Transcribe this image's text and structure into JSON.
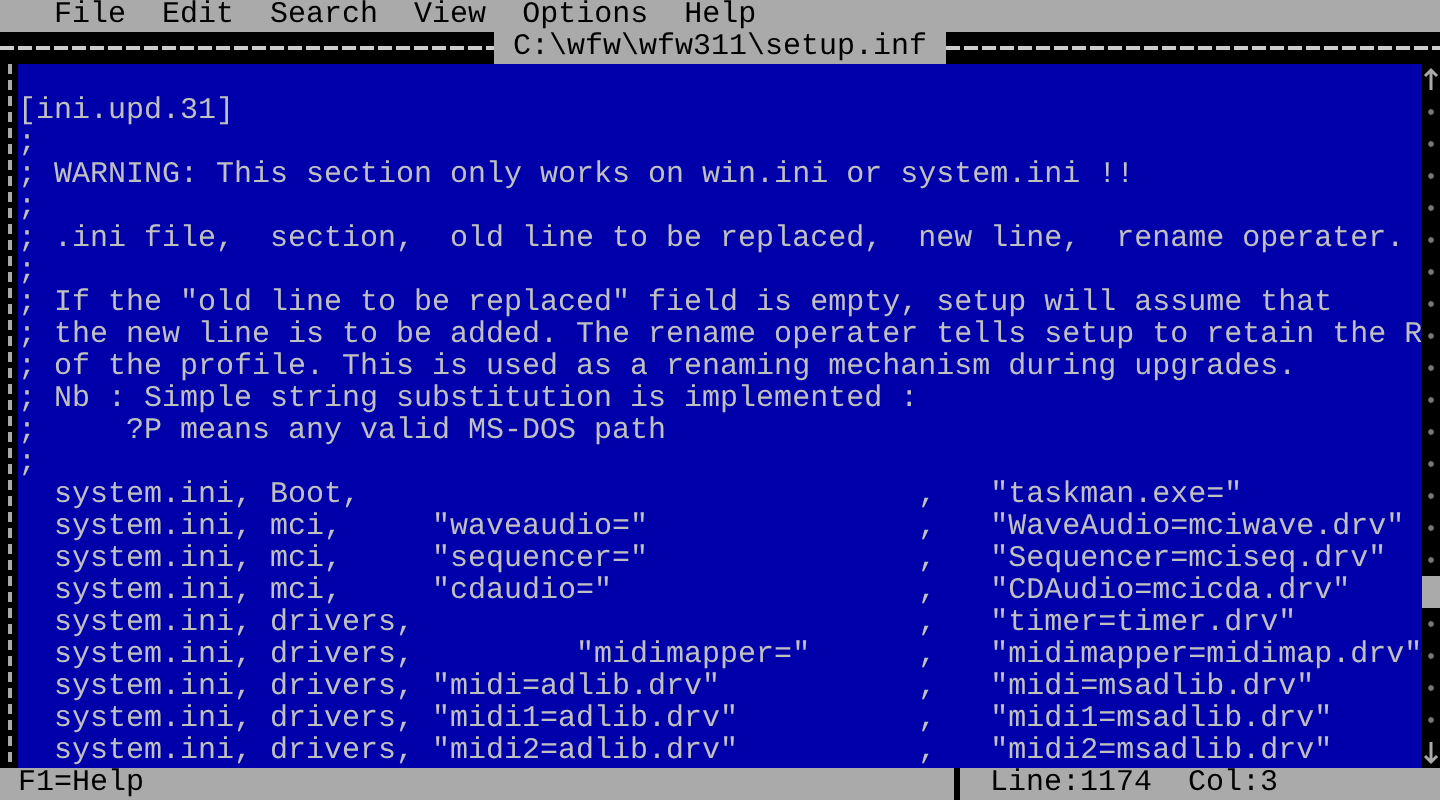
{
  "menu": [
    "File",
    "Edit",
    "Search",
    "View",
    "Options",
    "Help"
  ],
  "window": {
    "title": "C:\\wfw\\wfw311\\setup.inf"
  },
  "editor": {
    "lines": [
      "[ini.upd.31]",
      ";",
      "; WARNING: This section only works on win.ini or system.ini !!",
      ";",
      "; .ini file,  section,  old line to be replaced,  new line,  rename operater.",
      ";",
      "; If the \"old line to be replaced\" field is empty, setup will assume that",
      "; the new line is to be added. The rename operater tells setup to retain the R",
      "; of the profile. This is used as a renaming mechanism during upgrades.",
      "; Nb : Simple string substitution is implemented :",
      ";     ?P means any valid MS-DOS path",
      ";",
      "  system.ini, Boot,                               ,   \"taskman.exe=\"",
      "  system.ini, mci,     \"waveaudio=\"               ,   \"WaveAudio=mciwave.drv\"",
      "  system.ini, mci,     \"sequencer=\"               ,   \"Sequencer=mciseq.drv\"",
      "  system.ini, mci,     \"cdaudio=\"                 ,   \"CDAudio=mcicda.drv\"",
      "  system.ini, drivers,                            ,   \"timer=timer.drv\"",
      "  system.ini, drivers,         \"midimapper=\"      ,   \"midimapper=midimap.drv\"",
      "  system.ini, drivers, \"midi=adlib.drv\"           ,   \"midi=msadlib.drv\"",
      "  system.ini, drivers, \"midi1=adlib.drv\"          ,   \"midi1=msadlib.drv\"",
      "  system.ini, drivers, \"midi2=adlib.drv\"          ,   \"midi2=msadlib.drv\""
    ]
  },
  "status_bar": {
    "help": "F1=Help",
    "line": "Line:1174",
    "col": "Col:3"
  }
}
